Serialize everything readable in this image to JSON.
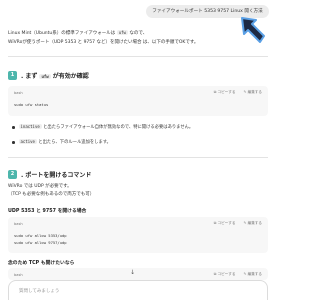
{
  "user_message": "ファイアウォールポート 5353 9757 Linux 開く方法",
  "intro": {
    "line1_before": "Linux Mint（Ubuntu系）の標準ファイアウォールは",
    "line1_code": "ufw",
    "line1_after": "なので、",
    "line2": "WiVRoが使うポート（UDP 5353 と 9757 など）を開けたい場合 は、以下の手順でOKです。"
  },
  "section1": {
    "number": "1",
    "title_before": ". まず",
    "title_code": "ufw",
    "title_after": "が有効か確認",
    "code_lang": "bash",
    "copy_label": "コピーする",
    "edit_label": "編集する",
    "code_lines": [
      "sudo ufw status"
    ],
    "bullets": [
      {
        "code": "inactive",
        "text": "と出たらファイアウォール自体が無効なので、特に開ける必要はありません。"
      },
      {
        "code": "active",
        "text": "と出たら、下のルール追加をします。"
      }
    ]
  },
  "section2": {
    "number": "2",
    "title": ". ポートを開けるコマンド",
    "line1": "WiVRo では UDP が必要です。",
    "line2": "（TCP も必要な例もあるので両方でも可）",
    "subhead": "UDP 5353 と 9757 を開ける場合",
    "code_lang": "bash",
    "copy_label": "コピーする",
    "edit_label": "編集する",
    "code_lines": [
      "sudo ufw allow 5353/udp",
      "sudo ufw allow 9757/udp"
    ],
    "subhead2": "念のため TCP も開けたいなら",
    "code2_lang": "bash",
    "code2_copy_label": "コピーする",
    "code2_edit_label": "編集する"
  },
  "composer_placeholder": "質問してみましょう",
  "colors": {
    "badge": "#4db6ac",
    "arrow_fill": "#1e2a44",
    "arrow_stroke": "#5aa0e6"
  }
}
